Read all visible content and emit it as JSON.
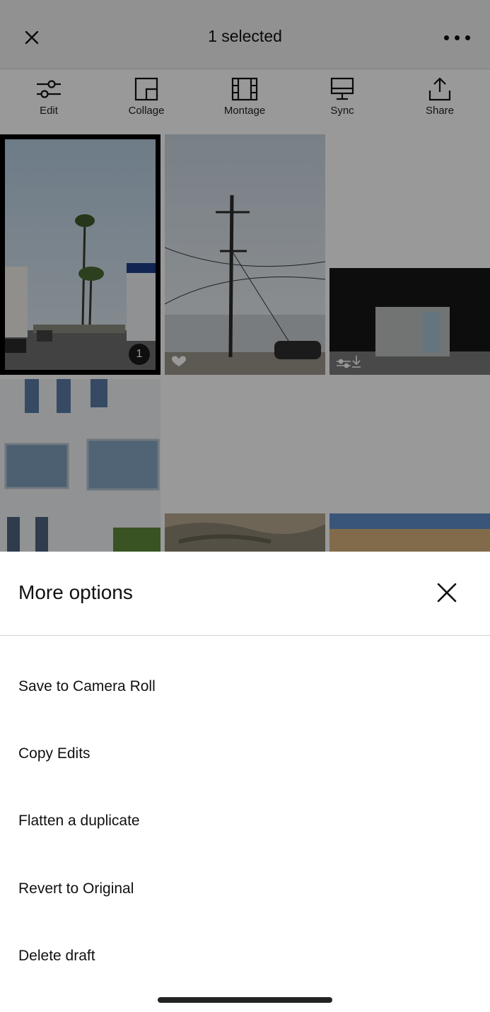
{
  "header": {
    "title": "1 selected"
  },
  "toolbar": [
    {
      "label": "Edit"
    },
    {
      "label": "Collage"
    },
    {
      "label": "Montage"
    },
    {
      "label": "Sync"
    },
    {
      "label": "Share"
    }
  ],
  "grid": {
    "selected_badge": "1"
  },
  "sheet": {
    "title": "More options",
    "options": [
      {
        "label": "Save to Camera Roll"
      },
      {
        "label": "Copy Edits"
      },
      {
        "label": "Flatten a duplicate"
      },
      {
        "label": "Revert to Original"
      },
      {
        "label": "Delete draft"
      }
    ]
  }
}
